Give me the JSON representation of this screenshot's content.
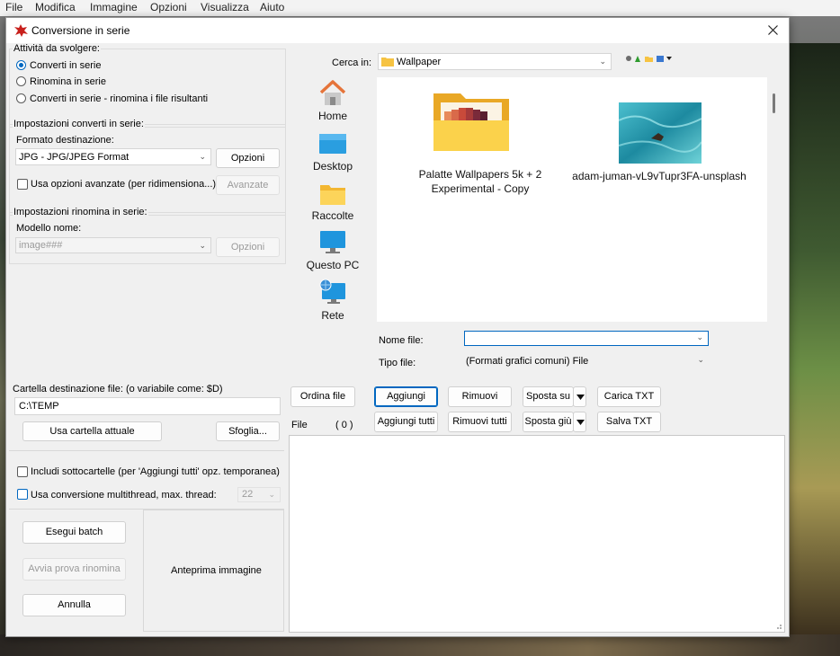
{
  "menubar": {
    "items": [
      "File",
      "Modifica",
      "Immagine",
      "Opzioni",
      "Visualizza",
      "Aiuto"
    ]
  },
  "dialog": {
    "title": "Conversione in serie",
    "tasks": {
      "heading": "Attività da svolgere:",
      "options": [
        "Converti in serie",
        "Rinomina in serie",
        "Converti in serie - rinomina i file risultanti"
      ],
      "selected": "Converti in serie"
    },
    "convert": {
      "heading": "Impostazioni converti in serie:",
      "format_label": "Formato destinazione:",
      "format_value": "JPG - JPG/JPEG Format",
      "options_button": "Opzioni",
      "advanced_checkbox": "Usa opzioni avanzate (per ridimensiona...)",
      "advanced_button": "Avanzate"
    },
    "rename": {
      "heading": "Impostazioni rinomina in serie:",
      "pattern_label": "Modello nome:",
      "pattern_value": "image###",
      "options_button": "Opzioni"
    },
    "destination": {
      "label": "Cartella destinazione file: (o variabile come: $D)",
      "value": "C:\\TEMP",
      "use_current_button": "Usa cartella attuale",
      "browse_button": "Sfoglia..."
    },
    "include_subfolders": "Includi sottocartelle (per 'Aggiungi tutti' opz. temporanea)",
    "multithread": {
      "label": "Usa conversione multithread, max. thread:",
      "value": "22"
    },
    "actions": {
      "run": "Esegui batch",
      "test_rename": "Avvia prova rinomina",
      "cancel": "Annulla"
    },
    "preview_label": "Anteprima immagine",
    "browser": {
      "lookin_label": "Cerca in:",
      "lookin_value": "Wallpaper",
      "places": [
        {
          "name": "Home",
          "icon": "home-icon"
        },
        {
          "name": "Desktop",
          "icon": "desktop-icon"
        },
        {
          "name": "Raccolte",
          "icon": "folder-icon"
        },
        {
          "name": "Questo PC",
          "icon": "computer-icon"
        },
        {
          "name": "Rete",
          "icon": "network-icon"
        }
      ],
      "items": [
        {
          "name": "Palatte Wallpapers 5k + 2 Experimental - Copy",
          "type": "folder"
        },
        {
          "name": "adam-juman-vL9vTupr3FA-unsplash",
          "type": "image"
        }
      ],
      "filename_label": "Nome file:",
      "filename_value": "",
      "filetype_label": "Tipo file:",
      "filetype_value": "(Formati grafici comuni) File"
    },
    "list_buttons": {
      "sort": "Ordina file",
      "add": "Aggiungi",
      "remove": "Rimuovi",
      "move_up": "Sposta su",
      "load_txt": "Carica TXT",
      "add_all": "Aggiungi tutti",
      "remove_all": "Rimuovi tutti",
      "move_down": "Sposta giù",
      "save_txt": "Salva TXT"
    },
    "file_list": {
      "label": "File",
      "count": "( 0 )"
    }
  },
  "colors": {
    "accent": "#0067c0",
    "folder": "#f6c342",
    "window_bg": "#f0f0f0"
  }
}
